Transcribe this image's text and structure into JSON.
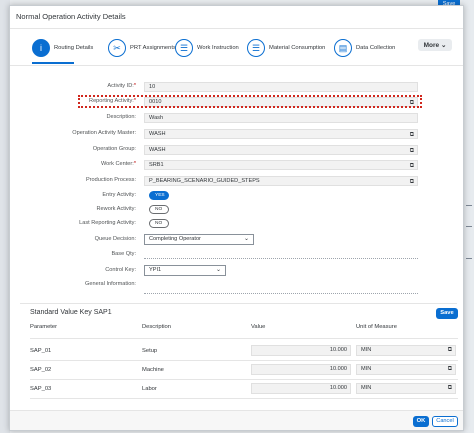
{
  "app": {
    "top_save_label": "Save"
  },
  "dialog": {
    "title": "Normal Operation Activity Details"
  },
  "tabs": [
    {
      "label": "Routing Details",
      "icon": "info-icon"
    },
    {
      "label": "PRT Assignments",
      "icon": "tools-icon"
    },
    {
      "label": "Work Instruction",
      "icon": "checklist-icon"
    },
    {
      "label": "Material Consumption",
      "icon": "checklist-icon"
    },
    {
      "label": "Data Collection",
      "icon": "data-collection-icon"
    }
  ],
  "more_label": "More",
  "form": {
    "activity_id": {
      "label": "Activity ID:",
      "value": "10"
    },
    "reporting_activity": {
      "label": "Reporting Activity:",
      "value": "0010"
    },
    "description": {
      "label": "Description:",
      "value": "Wash"
    },
    "operation_activity_master": {
      "label": "Operation Activity Master:",
      "value": "WASH"
    },
    "operation_group": {
      "label": "Operation Group:",
      "value": "WASH"
    },
    "work_center": {
      "label": "Work Center:",
      "value": "SRB1"
    },
    "production_process": {
      "label": "Production Process:",
      "value": "P_BEARING_SCENARIO_GUIDED_STEPS"
    },
    "entry_activity": {
      "label": "Entry Activity:",
      "value": "YES"
    },
    "rework_activity": {
      "label": "Rework Activity:",
      "value": "NO"
    },
    "last_reporting_activity": {
      "label": "Last Reporting Activity:",
      "value": "NO"
    },
    "queue_decision": {
      "label": "Queue Decision:",
      "value": "Completing Operator"
    },
    "base_qty": {
      "label": "Base Qty:",
      "value": ""
    },
    "control_key": {
      "label": "Control Key:",
      "value": "YPI1"
    },
    "general_information": {
      "label": "General Information:",
      "value": ""
    }
  },
  "standard_value": {
    "title": "Standard Value Key SAP1",
    "save_label": "Save",
    "headers": [
      "Parameter",
      "Description",
      "Value",
      "Unit of Measure"
    ],
    "rows": [
      {
        "parameter": "SAP_01",
        "description": "Setup",
        "value": "10.000",
        "unit": "MIN"
      },
      {
        "parameter": "SAP_02",
        "description": "Machine",
        "value": "10.000",
        "unit": "MIN"
      },
      {
        "parameter": "SAP_03",
        "description": "Labor",
        "value": "10.000",
        "unit": "MIN"
      }
    ]
  },
  "footer": {
    "ok_label": "OK",
    "cancel_label": "Cancel"
  },
  "colors": {
    "accent": "#0a6ed1",
    "highlight": "#d0271d",
    "required": "#bb0000"
  }
}
